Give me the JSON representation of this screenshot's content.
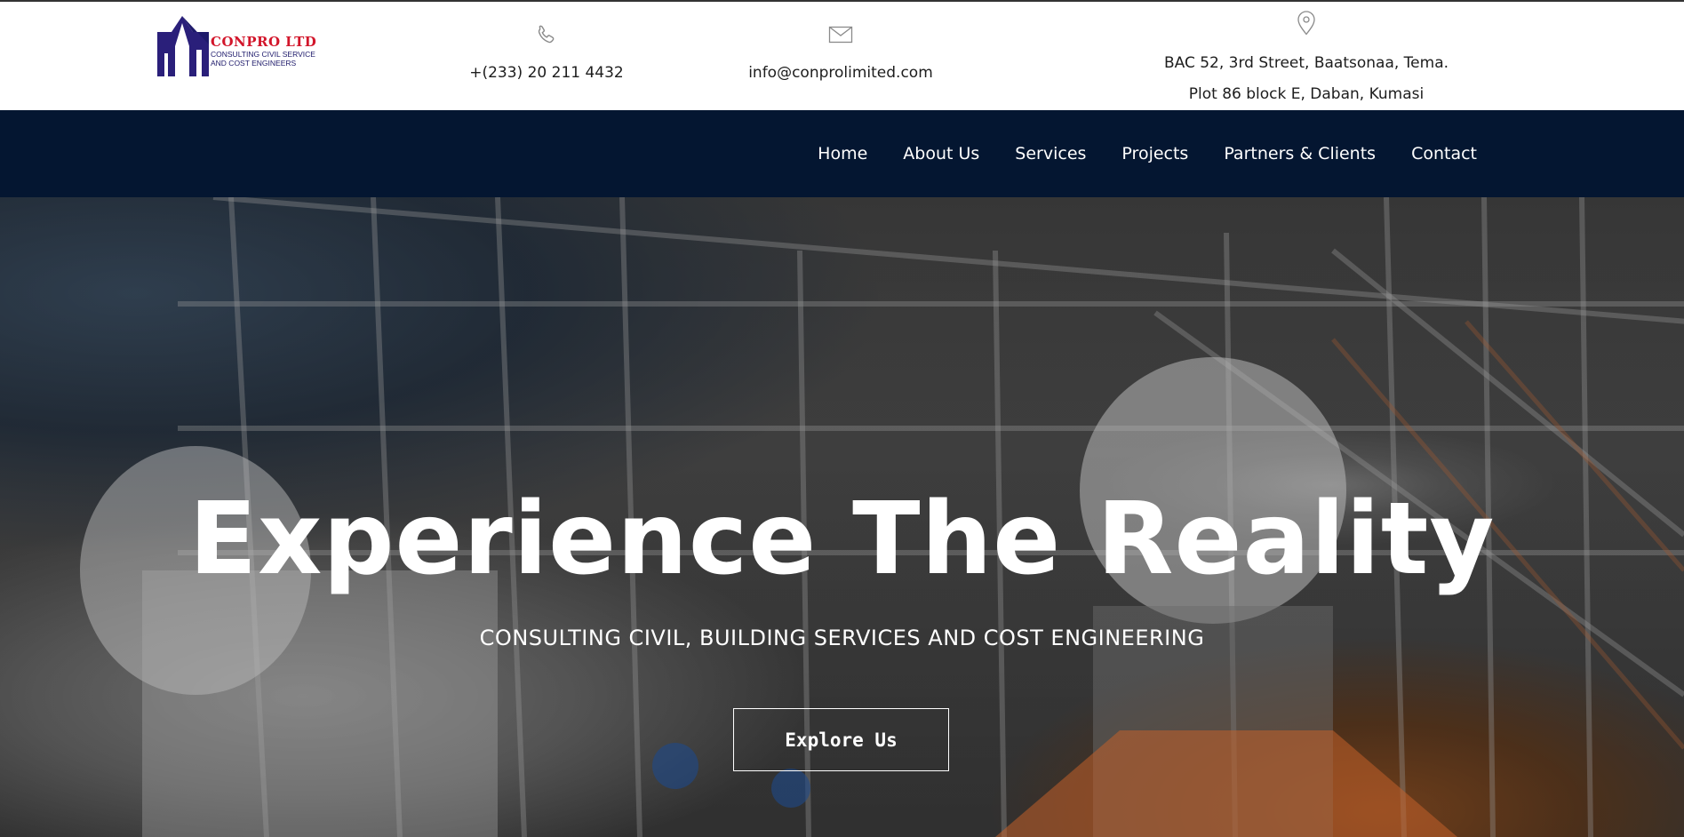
{
  "logo": {
    "name": "CONPRO LTD",
    "sub_line1": "CONSULTING CIVIL SERVICE",
    "sub_line2": "AND COST ENGINEERS"
  },
  "contact": {
    "phone": "+(233) 20 211 4432",
    "email": "info@conprolimited.com",
    "address_line1": "BAC 52, 3rd Street, Baatsonaa, Tema.",
    "address_line2": "Plot 86 block E, Daban, Kumasi",
    "phone_icon": "phone-icon",
    "email_icon": "envelope-icon",
    "location_icon": "map-pin-icon"
  },
  "nav": {
    "items": [
      {
        "label": "Home"
      },
      {
        "label": "About Us"
      },
      {
        "label": "Services"
      },
      {
        "label": "Projects"
      },
      {
        "label": "Partners & Clients"
      },
      {
        "label": "Contact"
      }
    ]
  },
  "hero": {
    "title": "Experience The Reality",
    "subtitle": "CONSULTING CIVIL, BUILDING SERVICES AND COST ENGINEERING",
    "button_label": "Explore Us"
  },
  "colors": {
    "nav_bg": "#041631",
    "logo_red": "#d2152a",
    "logo_blue": "#1e1a6b"
  }
}
